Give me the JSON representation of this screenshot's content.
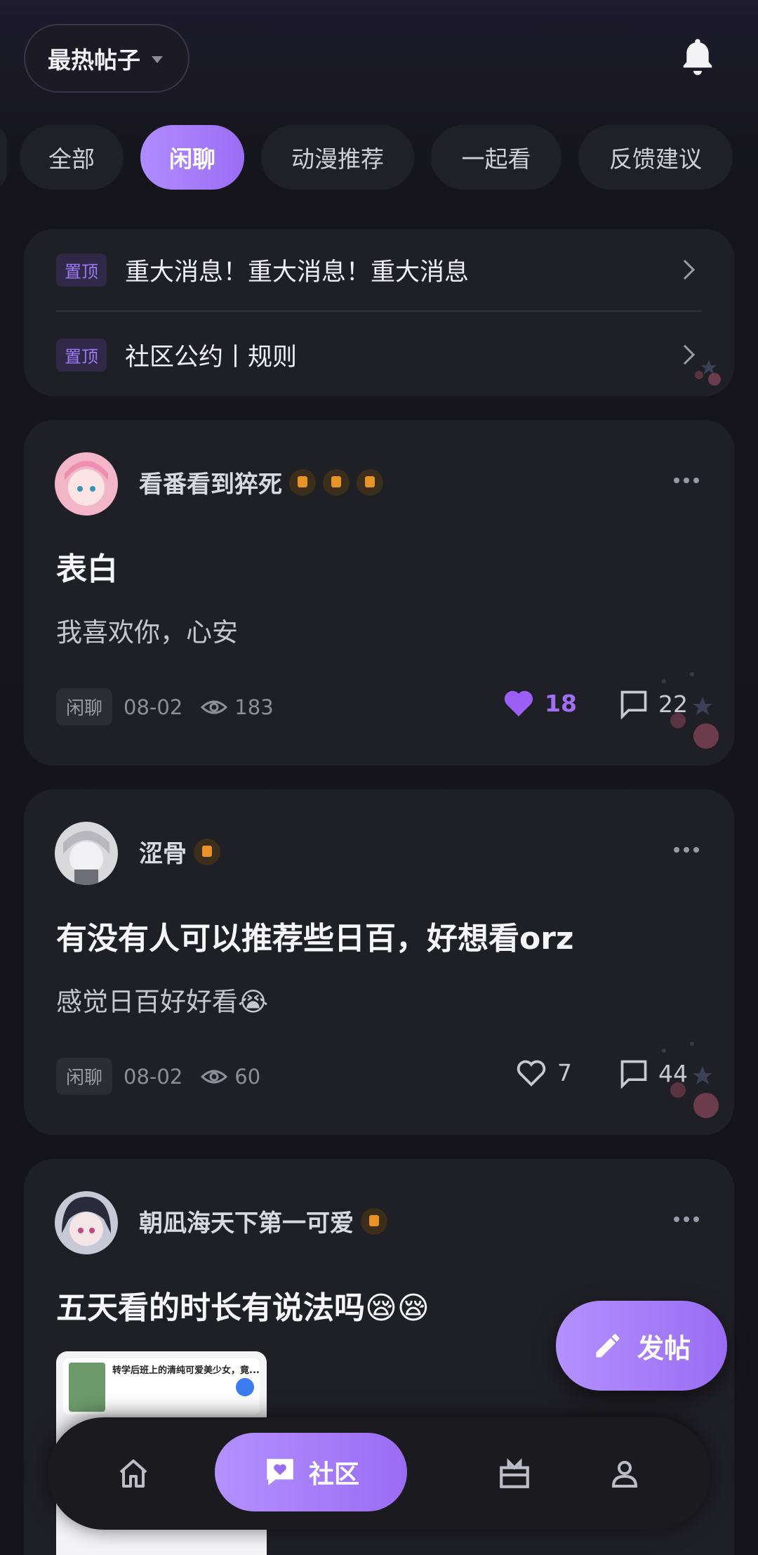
{
  "header": {
    "sort_label": "最热帖子"
  },
  "tabs": [
    {
      "label": "全部",
      "active": false
    },
    {
      "label": "闲聊",
      "active": true
    },
    {
      "label": "动漫推荐",
      "active": false
    },
    {
      "label": "一起看",
      "active": false
    },
    {
      "label": "反馈建议",
      "active": false
    }
  ],
  "pinned": [
    {
      "badge": "置顶",
      "text": "重大消息！重大消息！重大消息"
    },
    {
      "badge": "置顶",
      "text": "社区公约丨规则"
    }
  ],
  "posts": [
    {
      "author": "看番看到猝死",
      "title": "表白",
      "body": "我喜欢你，心安",
      "category": "闲聊",
      "date": "08-02",
      "views": "183",
      "likes": "18",
      "comments": "22",
      "liked": true
    },
    {
      "author": "涩骨",
      "title": "有没有人可以推荐些日百，好想看orz",
      "body": "感觉日百好好看😭",
      "category": "闲聊",
      "date": "08-02",
      "views": "60",
      "likes": "7",
      "comments": "44",
      "liked": false
    },
    {
      "author": "朝凪海天下第一可爱",
      "title": "五天看的时长有说法吗😪😪",
      "thumb_title": "转学后班上的清纯可爱美少女，竟..."
    }
  ],
  "fab": {
    "label": "发帖"
  },
  "bottom_nav": {
    "active_label": "社区"
  },
  "colors": {
    "accent": "#9b6df4",
    "card": "#1f1f26",
    "background": "#14141a"
  }
}
